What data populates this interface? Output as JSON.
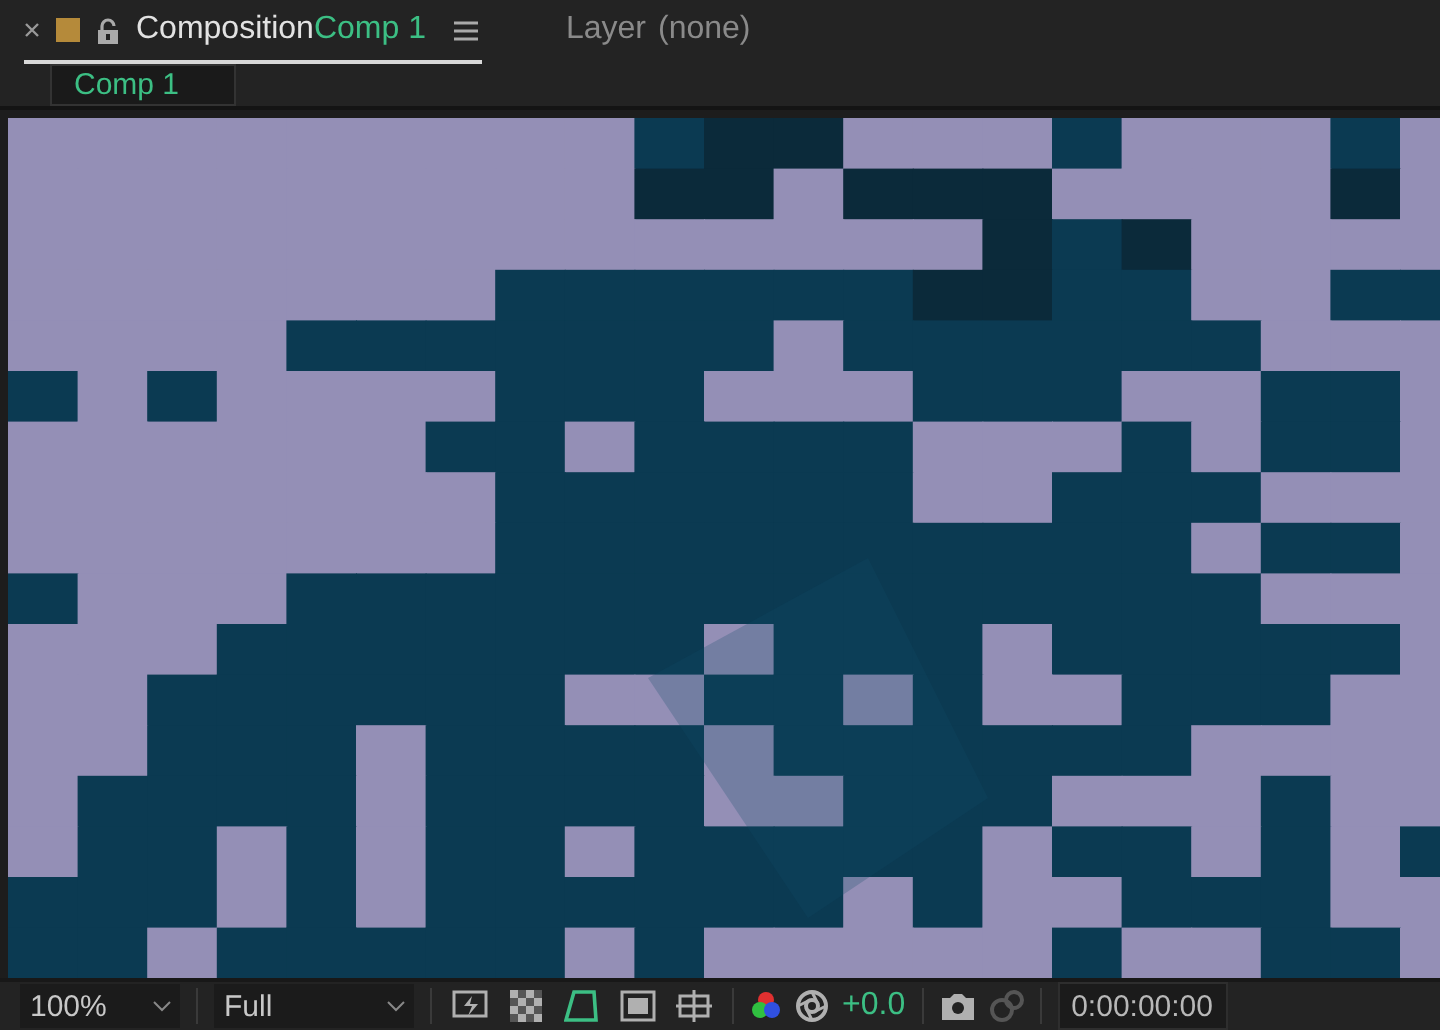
{
  "panel_tabs": [
    {
      "label": "Composition",
      "item": "Comp 1",
      "selected": true
    },
    {
      "label": "Layer",
      "item": "(none)",
      "selected": false
    }
  ],
  "breadcrumbs": [
    {
      "label": "Comp 1"
    }
  ],
  "viewer_toolbar": {
    "magnification": "100%",
    "resolution": "Full",
    "toggles": [
      {
        "kind": "fast-preview",
        "on": false
      },
      {
        "kind": "transparency-grid",
        "on": false
      },
      {
        "kind": "mask-path",
        "on": true
      },
      {
        "kind": "region-of-interest",
        "on": false
      },
      {
        "kind": "grid",
        "on": false
      }
    ],
    "exposure": "+0.0",
    "timecode": "0:00:00:00"
  }
}
